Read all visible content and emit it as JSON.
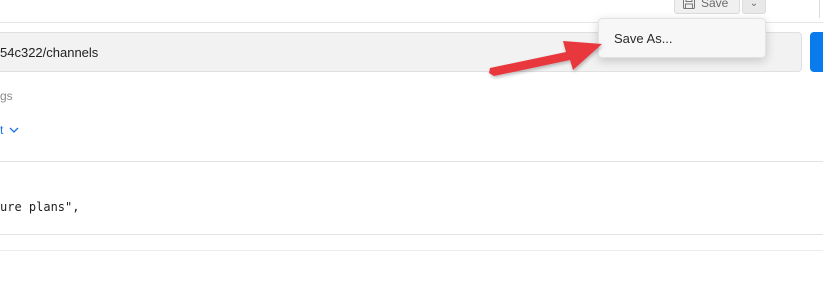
{
  "toolbar": {
    "save_label": "Save",
    "save_icon": "floppy-disk-icon",
    "caret_icon": "chevron-down-icon",
    "caret_glyph": "⌄",
    "more_icon": "more-horizontal-icon",
    "more_glyph": "···"
  },
  "request": {
    "url_value": "54c322/channels",
    "send_color": "#097BED"
  },
  "tabs": {
    "partial_label": "gs"
  },
  "body_type": {
    "partial_label": "t",
    "chevron_icon": "chevron-down-icon"
  },
  "body_code": {
    "line": "ure plans\","
  },
  "menu": {
    "items": [
      {
        "label": "Save As..."
      }
    ]
  },
  "annotation": {
    "arrow_color": "#E8383D",
    "arrow_icon": "arrow-right-icon"
  }
}
